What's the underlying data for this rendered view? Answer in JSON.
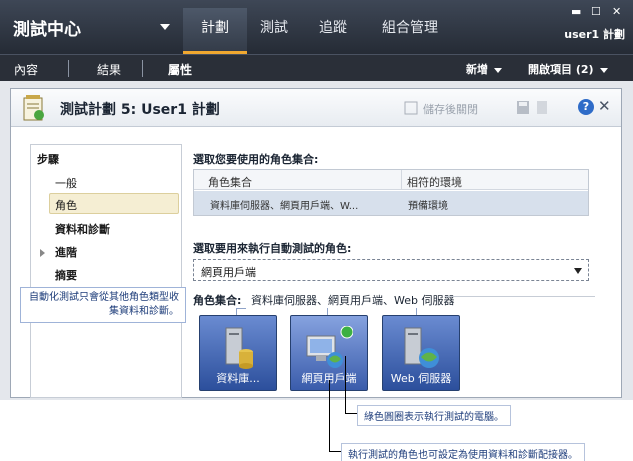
{
  "app": {
    "title": "測試中心",
    "user": "user1 計劃"
  },
  "main_tabs": [
    {
      "label": "計劃",
      "active": true
    },
    {
      "label": "測試",
      "active": false
    },
    {
      "label": "追蹤",
      "active": false
    },
    {
      "label": "組合管理",
      "active": false
    }
  ],
  "sub_tabs": [
    {
      "label": "內容"
    },
    {
      "label": "結果"
    },
    {
      "label": "屬性",
      "active": true
    }
  ],
  "sub_actions": {
    "new": "新增",
    "open_items": "開啟項目 (2)"
  },
  "panel": {
    "title": "測試計劃 5: User1 計劃",
    "save_close": "儲存後關閉",
    "help": "?"
  },
  "nav": {
    "heading": "步驟",
    "items": [
      {
        "label": "一般",
        "bold": false
      },
      {
        "label": "角色",
        "bold": false,
        "selected": true
      },
      {
        "label": "資料和診斷",
        "bold": true
      },
      {
        "label": "進階",
        "bold": true
      },
      {
        "label": "摘要",
        "bold": true
      }
    ]
  },
  "content": {
    "role_set_prompt": "選取您要使用的角色集合:",
    "grid_headers": [
      "角色集合",
      "相符的環境"
    ],
    "grid_row": [
      "資料庫伺服器、網頁用戶端、W...",
      "預備環境"
    ],
    "run_role_prompt": "選取要用來執行自動測試的角色:",
    "run_role_value": "網頁用戶端",
    "role_set_label": "角色集合:",
    "role_set_value": "資料庫伺服器、網頁用戶端、Web 伺服器",
    "roles": [
      {
        "label": "資料庫...",
        "icon": "database-server-icon"
      },
      {
        "label": "網頁用戶端",
        "icon": "web-client-icon",
        "selected": true
      },
      {
        "label": "Web 伺服器",
        "icon": "web-server-icon"
      }
    ]
  },
  "callouts": {
    "left": "自動化測試只會從其他角色類型收集資料和診斷。",
    "green": "綠色圓圈表示執行測試的電腦。",
    "bottom": "執行測試的角色也可設定為使用資料和診斷配接器。"
  },
  "colors": {
    "accent": "#f0a830",
    "tile": "#2c4f9c",
    "green_badge": "#3cb043"
  }
}
